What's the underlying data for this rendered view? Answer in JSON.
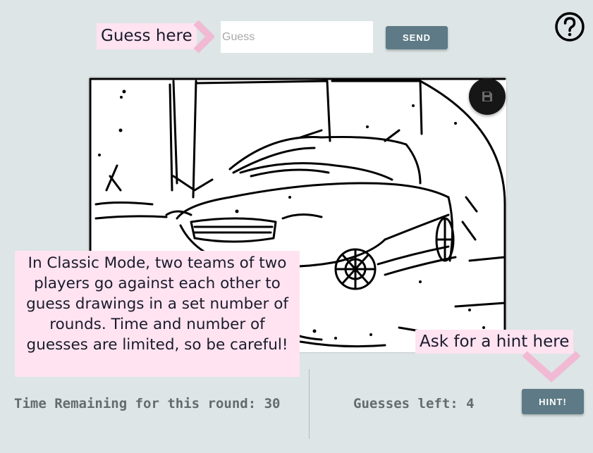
{
  "guess": {
    "tip_label": "Guess here",
    "placeholder": "Guess",
    "value": "",
    "send_label": "SEND"
  },
  "help": {
    "icon": "help-icon"
  },
  "canvas": {
    "save_icon": "save-icon",
    "drawing": "car line drawing"
  },
  "info_tip": {
    "text": "In Classic Mode, two teams of two players go against each other to guess drawings in a set number of rounds. Time and number of guesses are limited, so be careful!"
  },
  "hint": {
    "tip_label": "Ask for a hint here",
    "button_label": "HINT!"
  },
  "status": {
    "time_label": "Time Remaining for this round: 30",
    "guesses_label": "Guesses left: 4"
  },
  "colors": {
    "background": "#dde5e6",
    "button": "#5d7a86",
    "tip_background": "#ffe3f1",
    "tip_arrow": "#f1b9d3",
    "status_text": "#646b6e"
  }
}
